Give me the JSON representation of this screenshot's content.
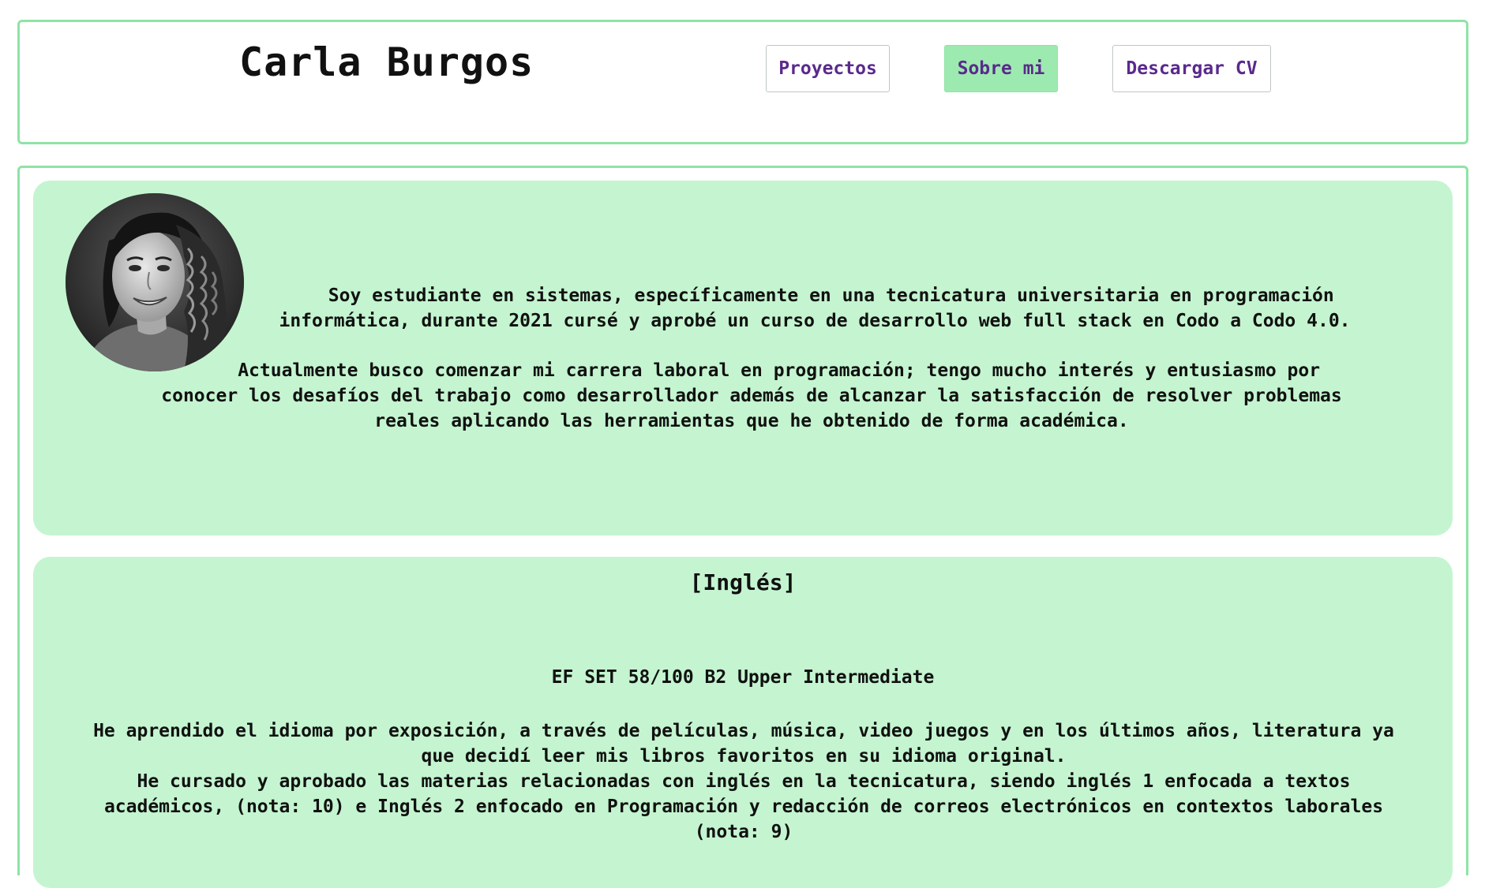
{
  "header": {
    "title": "Carla Burgos",
    "nav": {
      "projects": "Proyectos",
      "about": "Sobre mi",
      "download_cv": "Descargar CV"
    },
    "active_nav": "about"
  },
  "about": {
    "avatar_icon": "profile-photo",
    "paragraph_1": "   Soy estudiante en sistemas, específicamente en una tecnicatura universitaria en programación informática, durante 2021 cursé y aprobé un curso de desarrollo web full stack en Codo a Codo 4.0.",
    "paragraph_2": "     Actualmente busco comenzar mi carrera laboral en programación; tengo mucho interés y entusiasmo por conocer los desafíos del trabajo como desarrollador además de alcanzar la satisfacción de resolver problemas reales aplicando las herramientas que he obtenido de forma académica."
  },
  "english": {
    "title": "[Inglés]",
    "certification": "EF SET 58/100 B2 Upper Intermediate",
    "paragraph_1": "He aprendido el idioma por exposición, a través de películas, música, video juegos y en los últimos años, literatura ya que decidí leer mis libros favoritos en su idioma original.",
    "paragraph_2": "He cursado y aprobado las materias relacionadas con inglés en la tecnicatura, siendo inglés 1 enfocada a textos académicos, (nota: 10) e Inglés 2 enfocado en Programación y redacción de correos electrónicos en contextos laborales (nota: 9)"
  },
  "colors": {
    "accent_border": "#8fe3a6",
    "card_background": "#c4f5d0",
    "active_button": "#9deab0",
    "link_text": "#5a2a8c"
  }
}
